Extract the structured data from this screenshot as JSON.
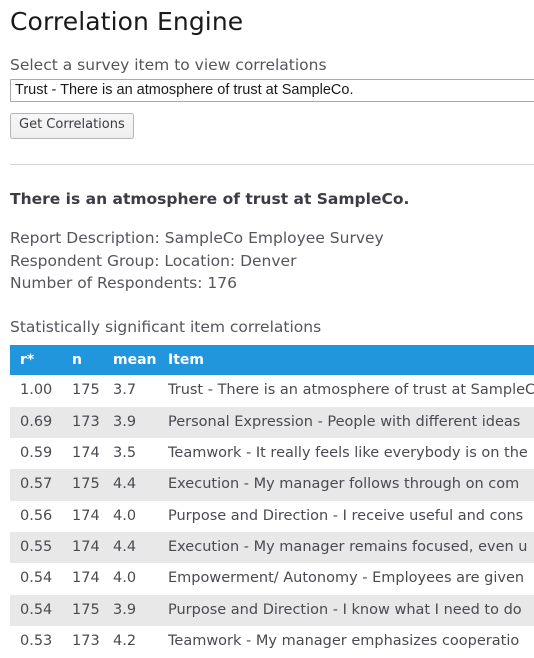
{
  "app": {
    "title": "Correlation Engine"
  },
  "form": {
    "select_label": "Select a survey item to view correlations",
    "selected_item": "Trust - There is an atmosphere of trust at SampleCo.",
    "submit_label": "Get Correlations"
  },
  "report": {
    "item_heading": "There is an atmosphere of trust at SampleCo.",
    "report_description": "Report Description: SampleCo Employee Survey",
    "respondent_group": "Respondent Group: Location: Denver",
    "number_of_respondents": "Number of Respondents: 176",
    "table_caption": "Statistically significant item correlations"
  },
  "table": {
    "columns": [
      "r*",
      "n",
      "mean",
      "Item"
    ],
    "rows": [
      {
        "r": "1.00",
        "n": "175",
        "mean": "3.7",
        "item": "Trust - There is an atmosphere of trust at SampleCo."
      },
      {
        "r": "0.69",
        "n": "173",
        "mean": "3.9",
        "item": "Personal Expression - People with different ideas"
      },
      {
        "r": "0.59",
        "n": "174",
        "mean": "3.5",
        "item": "Teamwork - It really feels like everybody is on the"
      },
      {
        "r": "0.57",
        "n": "175",
        "mean": "4.4",
        "item": "Execution - My manager follows through on com"
      },
      {
        "r": "0.56",
        "n": "174",
        "mean": "4.0",
        "item": "Purpose and Direction - I receive useful and cons"
      },
      {
        "r": "0.55",
        "n": "174",
        "mean": "4.4",
        "item": "Execution - My manager remains focused, even u"
      },
      {
        "r": "0.54",
        "n": "174",
        "mean": "4.0",
        "item": "Empowerment/ Autonomy - Employees are given"
      },
      {
        "r": "0.54",
        "n": "175",
        "mean": "3.9",
        "item": "Purpose and Direction - I know what I need to do"
      },
      {
        "r": "0.53",
        "n": "173",
        "mean": "4.2",
        "item": "Teamwork - My manager emphasizes cooperatio"
      }
    ]
  },
  "colors": {
    "header_blue": "#2196dd",
    "stripe_gray": "#e8e8e8",
    "body_text": "#4a4a52"
  }
}
